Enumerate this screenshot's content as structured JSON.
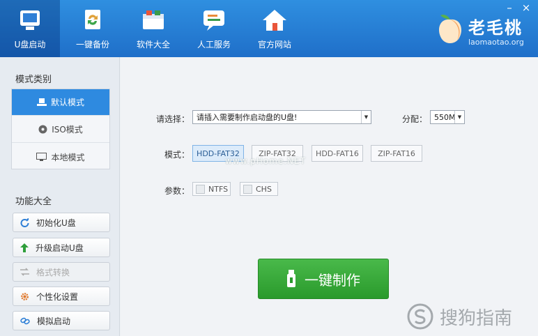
{
  "window": {
    "close_glyph": "×",
    "min_glyph": "–"
  },
  "nav": {
    "items": [
      {
        "label": "U盘启动",
        "icon": "usb-drive-icon"
      },
      {
        "label": "一键备份",
        "icon": "backup-refresh-icon"
      },
      {
        "label": "软件大全",
        "icon": "software-box-icon"
      },
      {
        "label": "人工服务",
        "icon": "chat-service-icon"
      },
      {
        "label": "官方网站",
        "icon": "home-icon"
      }
    ],
    "active_index": 0
  },
  "logo": {
    "name": "老毛桃",
    "url": "laomaotao.org",
    "icon": "peach-logo-icon"
  },
  "sidebar": {
    "mode_title": "模式类别",
    "modes": [
      {
        "label": "默认模式",
        "icon": "usb-mode-icon"
      },
      {
        "label": "ISO模式",
        "icon": "disc-icon"
      },
      {
        "label": "本地模式",
        "icon": "monitor-icon"
      }
    ],
    "active_mode": 0,
    "func_title": "功能大全",
    "functions": [
      {
        "label": "初始化U盘",
        "icon": "refresh-icon",
        "enabled": true
      },
      {
        "label": "升级启动U盘",
        "icon": "up-arrow-icon",
        "enabled": true
      },
      {
        "label": "格式转换",
        "icon": "convert-icon",
        "enabled": false
      },
      {
        "label": "个性化设置",
        "icon": "gear-icon",
        "enabled": true
      },
      {
        "label": "模拟启动",
        "icon": "link-icon",
        "enabled": true
      }
    ]
  },
  "main": {
    "select_label": "请选择：",
    "select_value": "请插入需要制作启动盘的U盘!",
    "partition_label": "分配：",
    "partition_value": "550M",
    "mode_label": "模式：",
    "modes": [
      "HDD-FAT32",
      "ZIP-FAT32",
      "HDD-FAT16",
      "ZIP-FAT16"
    ],
    "active_mode": 0,
    "param_label": "参数：",
    "params": [
      "NTFS",
      "CHS"
    ],
    "make_button": "一键制作",
    "watermark": "www.pHome.NET",
    "corner_watermark": "搜狗指南",
    "colors": {
      "accent": "#2e8ae0",
      "make": "#2a9a2c"
    }
  }
}
